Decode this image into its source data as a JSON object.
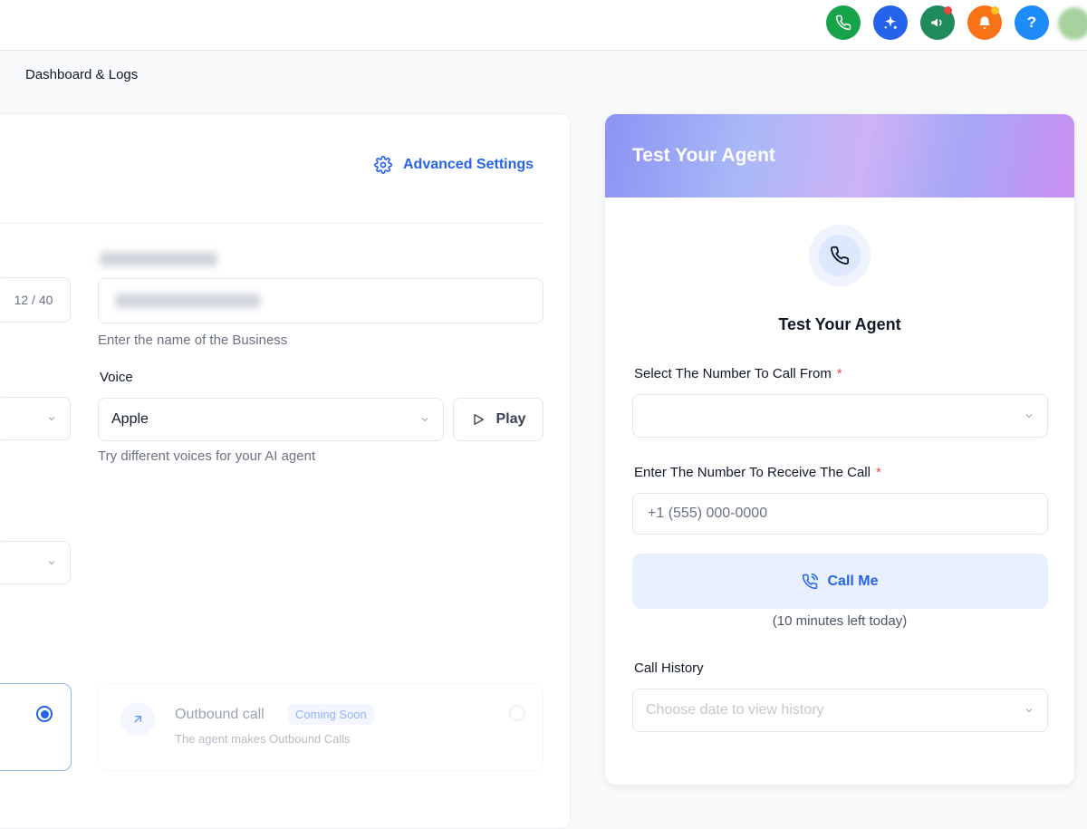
{
  "topbar": {
    "icons": [
      {
        "name": "phone-icon",
        "color": "#16a34a"
      },
      {
        "name": "sparkle-icon",
        "color": "#2563eb"
      },
      {
        "name": "megaphone-icon",
        "color": "#1f8a5b",
        "badge_color": "#ef4444"
      },
      {
        "name": "bell-icon",
        "color": "#f97316",
        "badge_color": "#fbbf24"
      },
      {
        "name": "help-icon",
        "color": "#1d8cf8",
        "glyph": "?"
      }
    ]
  },
  "breadcrumb": "Dashboard & Logs",
  "config": {
    "advanced_settings": "Advanced Settings",
    "name_counter": "12 / 40",
    "business_help": "Enter the name of the Business",
    "voice_label": "Voice",
    "voice_value": "Apple",
    "play_label": "Play",
    "voice_help": "Try different voices for your AI agent",
    "outbound_title": "Outbound call",
    "coming_soon": "Coming Soon",
    "outbound_desc": "The agent makes Outbound Calls"
  },
  "test_panel": {
    "header_title": "Test Your Agent",
    "title": "Test Your Agent",
    "from_label": "Select The Number To Call From",
    "required_mark": "*",
    "receive_label": "Enter The Number To Receive The Call",
    "receive_placeholder": "+1 (555) 000-0000",
    "call_button": "Call Me",
    "minutes_left": "(10 minutes left today)",
    "history_label": "Call History",
    "history_placeholder": "Choose date to view history"
  },
  "colors": {
    "accent": "#2563eb",
    "required": "#ef4444"
  }
}
